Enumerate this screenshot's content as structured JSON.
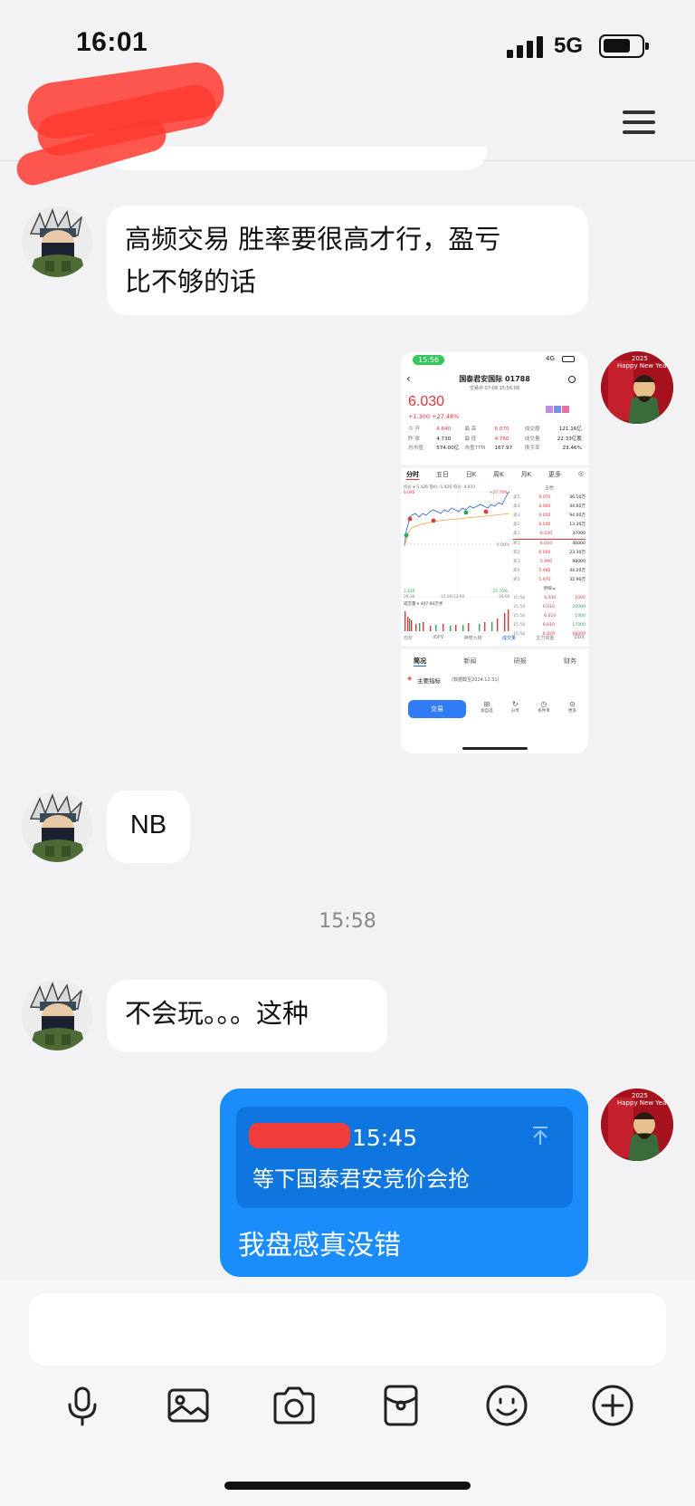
{
  "status_bar": {
    "time": "16:01",
    "network": "5G"
  },
  "messages": {
    "m1": {
      "line1": "高频交易 胜率要很高才行，盈亏",
      "line2": "比不够的话"
    },
    "m3": {
      "text": "NB"
    },
    "timestamp": "15:58",
    "m4": {
      "text": "不会玩。。。这种"
    },
    "m5": {
      "quote_time": "15:45",
      "quote_text": "等下国泰君安竞价会抢",
      "text": "我盘感真没错"
    }
  },
  "avatar_right": {
    "badge_year": "2025",
    "badge_text": "Happy New Yea"
  },
  "screenshot": {
    "status_time": "15:56",
    "network": "4G",
    "title": "国泰君安国际 01788",
    "subtitle": "交易中 07-08 15:56:08",
    "price": "6.030",
    "change": "+1.300  +27.48%",
    "stats": [
      [
        "今 开",
        "4.840",
        "最 高",
        "6.070",
        "成交额",
        "121.16亿"
      ],
      [
        "昨 收",
        "4.730",
        "最 低",
        "4.760",
        "成交量",
        "22.33亿股"
      ],
      [
        "总市值",
        "574.00亿",
        "市盈TTM",
        "167.97",
        "换手率",
        "23.46%"
      ]
    ],
    "tabs": [
      "分时",
      "五日",
      "日K",
      "周K",
      "月K",
      "更多"
    ],
    "chart_legend": "均价 ▾  5.426  现价: 5.426  均价: 4.811",
    "y_top": "6.040",
    "y_mid": "4.730",
    "y_bot": "3.420",
    "pct_top": "+27.70%",
    "pct_mid": "0.00%",
    "pct_bot": "-27.70%",
    "x_left": "09:30",
    "x_mid": "12:00/13:00",
    "x_right": "16:00",
    "volume_label": "成交量 ▾  407.00万手",
    "book_title": "五档",
    "asks": [
      [
        "卖5",
        "6.070",
        "46.10万"
      ],
      [
        "卖4",
        "6.060",
        "44.60万"
      ],
      [
        "卖3",
        "6.050",
        "94.00万"
      ],
      [
        "卖2",
        "6.040",
        "13.30万"
      ],
      [
        "卖1",
        "6.030",
        "37000"
      ]
    ],
    "bids": [
      [
        "买1",
        "6.010",
        "46000"
      ],
      [
        "买2",
        "6.000",
        "23.30万"
      ],
      [
        "买3",
        "5.990",
        "98000"
      ],
      [
        "买4",
        "5.980",
        "44.20万"
      ],
      [
        "买5",
        "5.970",
        "32.90万"
      ]
    ],
    "detail_title": "明细 ▴",
    "trades": [
      [
        "15:56",
        "6.030",
        "1000"
      ],
      [
        "15:56",
        "6.010",
        "20000"
      ],
      [
        "15:56",
        "6.010",
        "1000"
      ],
      [
        "15:56",
        "6.010",
        "17000"
      ],
      [
        "15:56",
        "6.020",
        "68000"
      ]
    ],
    "indicator_tabs": [
      "均价",
      "IOPV",
      "神奇九转",
      "成交量",
      "主力资金",
      "DDX"
    ],
    "section_tabs": [
      "简况",
      "新闻",
      "研报",
      "财务"
    ],
    "main_indicator": "主要指标",
    "indicator_date": "(数据截至2024.12.31)",
    "trade_btn": "交易",
    "bottom_actions": [
      "加自选",
      "分享",
      "条件单",
      "更多"
    ]
  }
}
